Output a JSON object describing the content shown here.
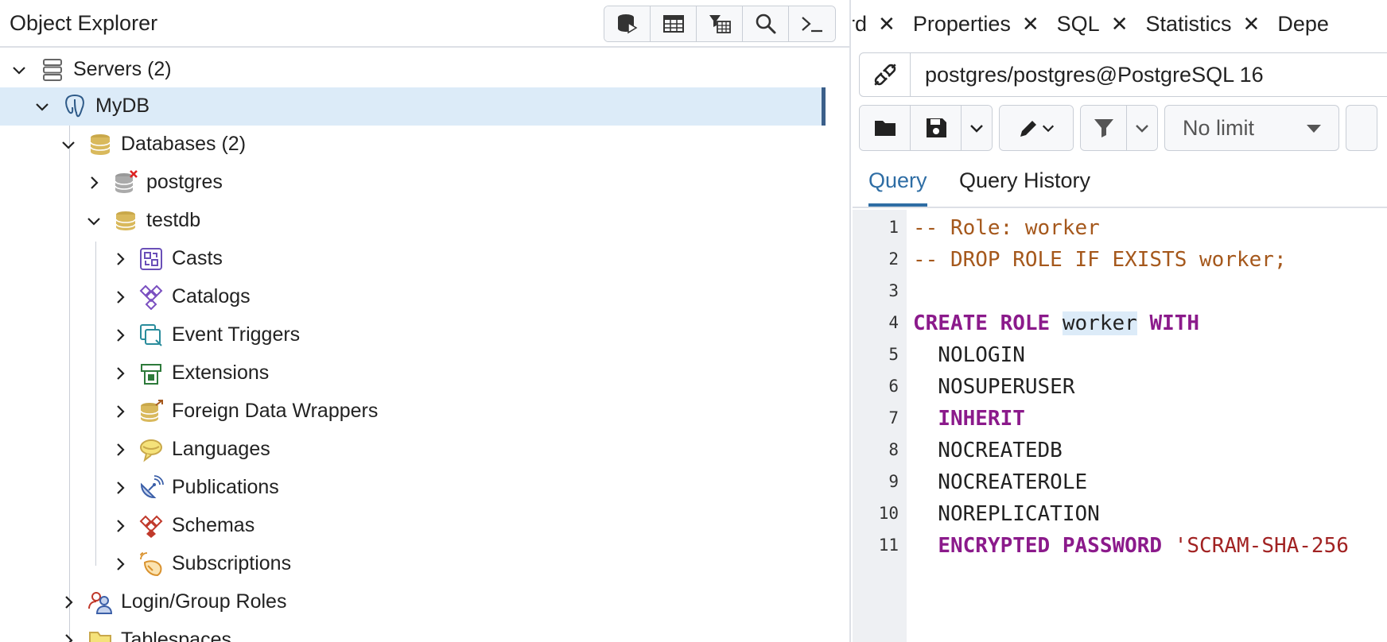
{
  "object_explorer": {
    "title": "Object Explorer",
    "toolbar": [
      {
        "icon": "query-tool-icon"
      },
      {
        "icon": "view-data-icon"
      },
      {
        "icon": "filtered-rows-icon"
      },
      {
        "icon": "search-objects-icon"
      },
      {
        "icon": "psql-tool-icon"
      }
    ],
    "tree": [
      {
        "label": "Servers (2)",
        "icon": "servers-icon",
        "expanded": true
      },
      {
        "label": "MyDB",
        "icon": "postgres-server-icon",
        "expanded": true,
        "selected": true
      },
      {
        "label": "Databases (2)",
        "icon": "databases-icon",
        "expanded": true
      },
      {
        "label": "postgres",
        "icon": "database-disconnected-icon",
        "expanded": false
      },
      {
        "label": "testdb",
        "icon": "database-icon",
        "expanded": true
      },
      {
        "label": "Casts",
        "icon": "casts-icon",
        "expanded": false
      },
      {
        "label": "Catalogs",
        "icon": "catalogs-icon",
        "expanded": false
      },
      {
        "label": "Event Triggers",
        "icon": "event-triggers-icon",
        "expanded": false
      },
      {
        "label": "Extensions",
        "icon": "extensions-icon",
        "expanded": false
      },
      {
        "label": "Foreign Data Wrappers",
        "icon": "foreign-data-wrappers-icon",
        "expanded": false
      },
      {
        "label": "Languages",
        "icon": "languages-icon",
        "expanded": false
      },
      {
        "label": "Publications",
        "icon": "publications-icon",
        "expanded": false
      },
      {
        "label": "Schemas",
        "icon": "schemas-icon",
        "expanded": false
      },
      {
        "label": "Subscriptions",
        "icon": "subscriptions-icon",
        "expanded": false
      },
      {
        "label": "Login/Group Roles",
        "icon": "login-group-roles-icon",
        "expanded": false
      },
      {
        "label": "Tablespaces",
        "icon": "tablespaces-icon",
        "expanded": false
      }
    ]
  },
  "tabs": [
    {
      "label": "rd"
    },
    {
      "label": "Properties"
    },
    {
      "label": "SQL"
    },
    {
      "label": "Statistics"
    },
    {
      "label": "Depe"
    }
  ],
  "connection": {
    "text": "postgres/postgres@PostgreSQL 16"
  },
  "query_toolbar": {
    "limit": "No limit"
  },
  "subtabs": {
    "query": "Query",
    "history": "Query History"
  },
  "editor": {
    "lines": [
      {
        "n": "1",
        "text": "-- Role: worker"
      },
      {
        "n": "2",
        "text": "-- DROP ROLE IF EXISTS worker;"
      },
      {
        "n": "3",
        "text": ""
      },
      {
        "n": "4",
        "text": "CREATE ROLE worker WITH"
      },
      {
        "n": "5",
        "text": "  NOLOGIN"
      },
      {
        "n": "6",
        "text": "  NOSUPERUSER"
      },
      {
        "n": "7",
        "text": "  INHERIT"
      },
      {
        "n": "8",
        "text": "  NOCREATEDB"
      },
      {
        "n": "9",
        "text": "  NOCREATEROLE"
      },
      {
        "n": "10",
        "text": "  NOREPLICATION"
      },
      {
        "n": "11",
        "text": "  ENCRYPTED PASSWORD 'SCRAM-SHA-256"
      }
    ]
  },
  "colors": {
    "accent": "#2e6da4",
    "selected_bg": "#dcebf8",
    "keyword": "#8b1a8b",
    "comment": "#a5581c"
  }
}
